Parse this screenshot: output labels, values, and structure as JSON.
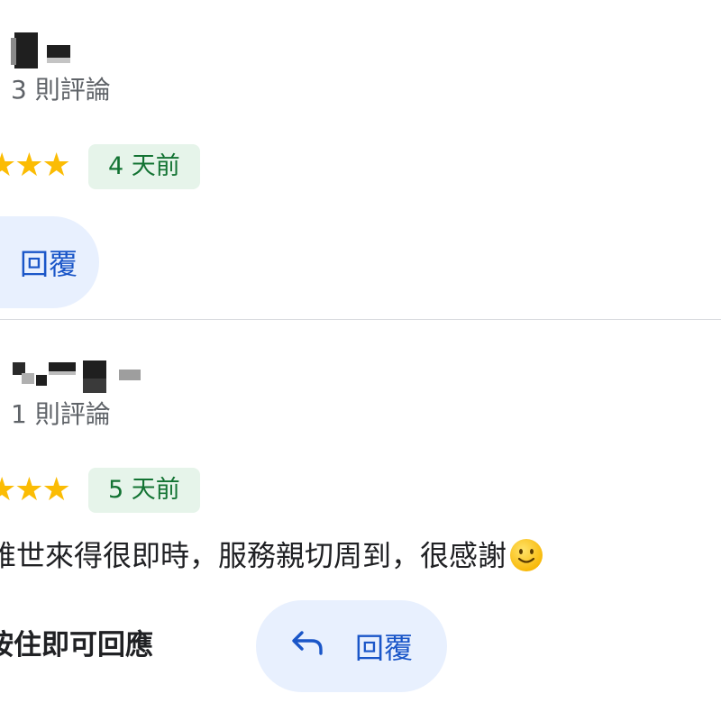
{
  "reviews": [
    {
      "review_count": "3 則評論",
      "stars": "★★★",
      "time_ago": "4 天前",
      "reply_label": "回覆"
    },
    {
      "review_count": "1 則評論",
      "stars": "★★★",
      "time_ago": "5 天前",
      "text": "誰世來得很即時，服務親切周到，很感謝",
      "emoji": "slightly-smiling-face-icon",
      "hint": "按住即可回應",
      "reply_label": "回覆",
      "reply_icon": "reply-arrow-icon"
    }
  ],
  "colors": {
    "star": "#fbbc04",
    "badge_bg": "#e6f4ea",
    "badge_text": "#137333",
    "reply_bg": "#e8f0fe",
    "reply_text": "#1a56c8"
  }
}
